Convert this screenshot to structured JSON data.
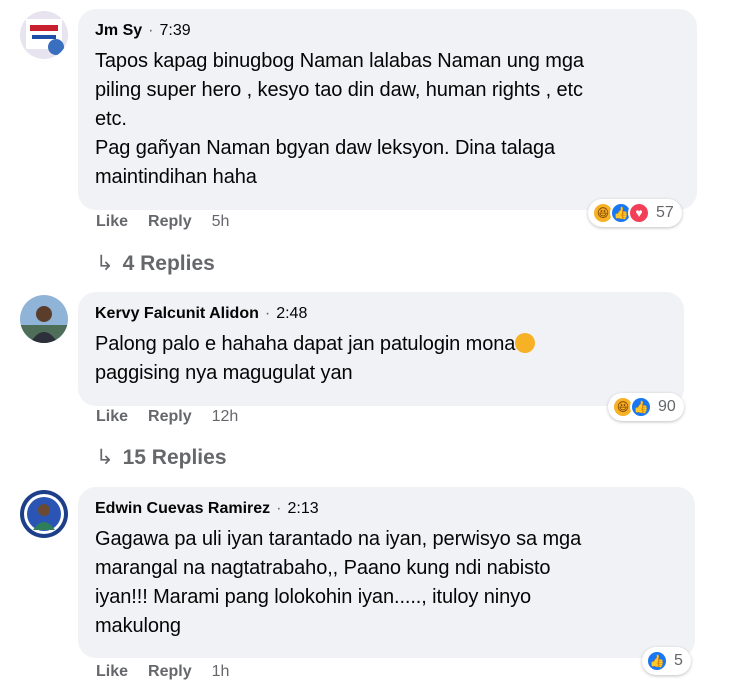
{
  "comments": [
    {
      "name": "Jm Sy",
      "time": "7:39",
      "text": "Tapos kapag binugbog Naman lalabas Naman ung mga\npiling super hero , kesyo tao din daw, human rights , etc\netc.\nPag gañyan Naman bgyan daw leksyon. Dina talaga\nmaintindihan haha",
      "like_label": "Like",
      "reply_label": "Reply",
      "age": "5h",
      "reaction_icons": [
        "haha-icon",
        "like-icon",
        "love-icon"
      ],
      "reaction_count": "57",
      "replies_label": "4 Replies"
    },
    {
      "name": "Kervy Falcunit Alidon",
      "time": "2:48",
      "text_line1": "Palong palo e hahaha dapat jan patulogin mona",
      "text_line2": "paggising nya magugulat yan",
      "like_label": "Like",
      "reply_label": "Reply",
      "age": "12h",
      "reaction_icons": [
        "haha-icon",
        "like-icon"
      ],
      "reaction_count": "90",
      "replies_label": "15 Replies"
    },
    {
      "name": "Edwin Cuevas Ramirez",
      "time": "2:13",
      "text": "Gagawa pa uli iyan tarantado na iyan, perwisyo sa mga\nmarangal na nagtatrabaho,, Paano kung ndi nabisto\niyan!!! Marami pang lolokohin iyan....., ituloy ninyo\nmakulong",
      "like_label": "Like",
      "reply_label": "Reply",
      "age": "1h",
      "reaction_icons": [
        "like-icon"
      ],
      "reaction_count": "5"
    }
  ],
  "separator": "·",
  "colors": {
    "bubble": "#f0f2f5",
    "secondary_text": "#65676b",
    "like_blue": "#1877f2",
    "haha_yellow": "#f7b125",
    "love_red": "#f33e58"
  }
}
